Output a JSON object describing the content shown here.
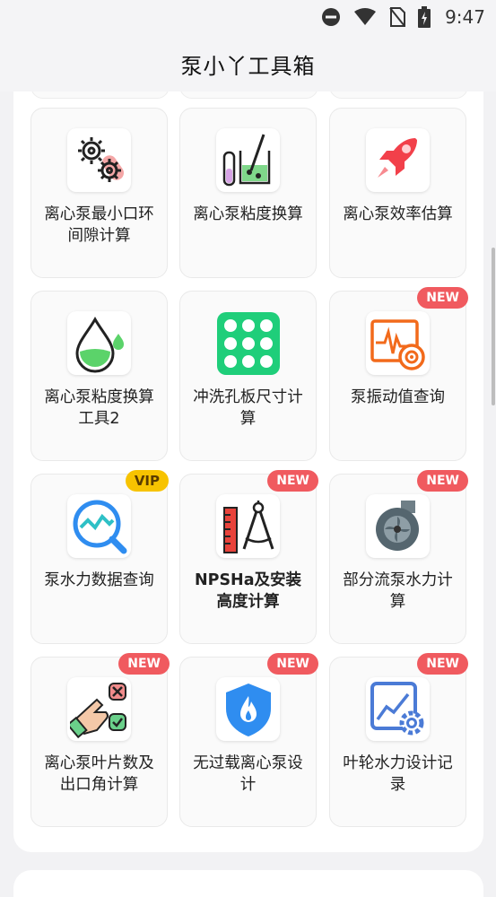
{
  "status_bar": {
    "time": "9:47",
    "icons": [
      "do-not-disturb-icon",
      "wifi-icon",
      "no-sim-icon",
      "battery-charging-icon"
    ]
  },
  "header": {
    "title": "泵小丫工具箱"
  },
  "colors": {
    "new_badge": "#f05a5f",
    "vip_badge": "#f7c300",
    "rocket": "#f2404a",
    "green": "#2ed27d",
    "blue": "#2f8df0"
  },
  "tools": [
    {
      "label": "离心泵最小口环间隙计算",
      "icon": "gears-icon",
      "badge": ""
    },
    {
      "label": "离心泵粘度换算",
      "icon": "lab-beaker-icon",
      "badge": ""
    },
    {
      "label": "离心泵效率估算",
      "icon": "rocket-icon",
      "badge": ""
    },
    {
      "label": "离心泵粘度换算工具2",
      "icon": "water-drop-icon",
      "badge": ""
    },
    {
      "label": "冲洗孔板尺寸计算",
      "icon": "orifice-plate-icon",
      "badge": ""
    },
    {
      "label": "泵振动值查询",
      "icon": "vibration-monitor-icon",
      "badge": "NEW"
    },
    {
      "label": "泵水力数据查询",
      "icon": "search-chart-icon",
      "badge": "VIP"
    },
    {
      "label": "NPSHa及安装高度计算",
      "icon": "compass-ruler-icon",
      "badge": "NEW"
    },
    {
      "label": "部分流泵水力计算",
      "icon": "pump-casing-icon",
      "badge": "NEW"
    },
    {
      "label": "离心泵叶片数及出口角计算",
      "icon": "hand-choice-icon",
      "badge": "NEW"
    },
    {
      "label": "无过载离心泵设计",
      "icon": "fire-shield-icon",
      "badge": "NEW"
    },
    {
      "label": "叶轮水力设计记录",
      "icon": "chart-gear-icon",
      "badge": "NEW"
    }
  ]
}
